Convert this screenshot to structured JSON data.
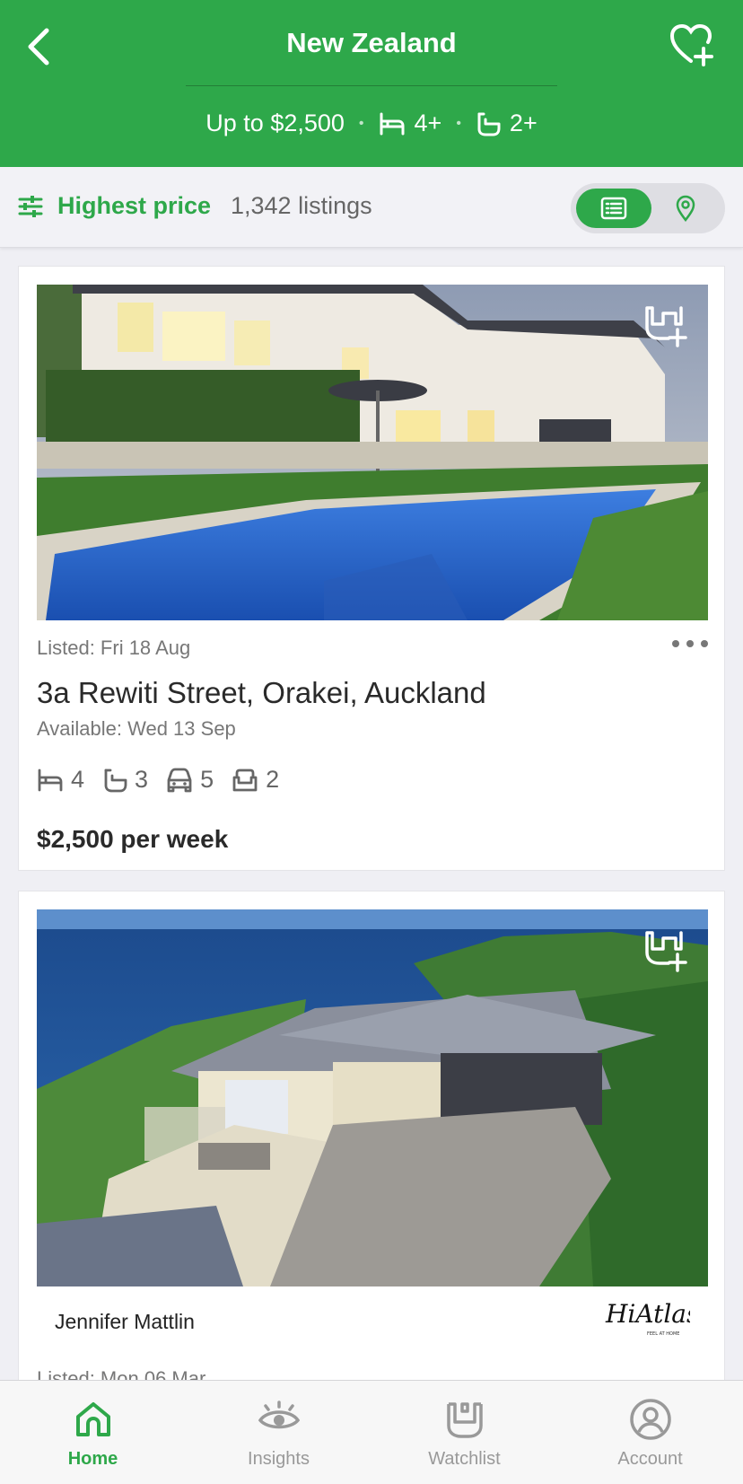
{
  "header": {
    "title": "New Zealand",
    "price_filter": "Up to $2,500",
    "bed_filter": "4+",
    "bath_filter": "2+",
    "separator": "•"
  },
  "sortbar": {
    "sort_label": "Highest price",
    "listing_count": "1,342 listings",
    "active_view": "list"
  },
  "listings": [
    {
      "listed": "Listed: Fri 18 Aug",
      "address": "3a Rewiti Street, Orakei, Auckland",
      "available": "Available: Wed 13 Sep",
      "beds": "4",
      "baths": "3",
      "parking": "5",
      "lounges": "2",
      "price": "$2,500 per week"
    },
    {
      "agent": "Jennifer Mattlin",
      "agency_logo": "HiAtlas",
      "agency_tagline": "FEEL AT HOME",
      "listed": "Listed: Mon 06 Mar"
    }
  ],
  "tabs": [
    {
      "label": "Home",
      "icon": "home-icon",
      "active": true
    },
    {
      "label": "Insights",
      "icon": "eye-icon",
      "active": false
    },
    {
      "label": "Watchlist",
      "icon": "watchlist-icon",
      "active": false
    },
    {
      "label": "Account",
      "icon": "user-circle-icon",
      "active": false
    }
  ],
  "colors": {
    "brand_green": "#2ea84a",
    "background": "#efeff4"
  }
}
